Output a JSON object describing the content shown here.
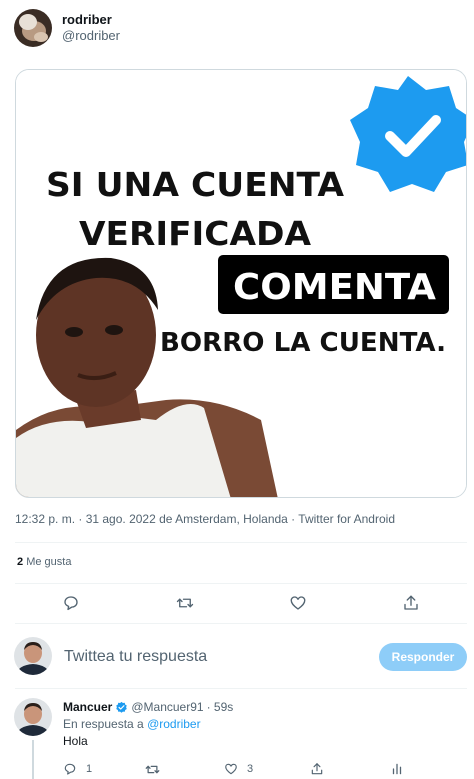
{
  "author": {
    "name": "rodriber",
    "handle": "@rodriber"
  },
  "media": {
    "line1": "SI UNA CUENTA",
    "line2": "VERIFICADA",
    "line3": "COMENTA",
    "line4": "BORRO LA CUENTA."
  },
  "meta": {
    "text": "12:32 p. m. · 31 ago. 2022 de Amsterdam, Holanda · Twitter for Android"
  },
  "likes": {
    "count": "2",
    "label": "Me gusta"
  },
  "compose": {
    "placeholder": "Twittea tu respuesta",
    "button": "Responder"
  },
  "reply": {
    "name": "Mancuer",
    "handle": "@Mancuer91",
    "time": "· 59s",
    "replying_prefix": "En respuesta a",
    "replying_to": "@rodriber",
    "text": "Hola",
    "reply_count": "1",
    "like_count": "3"
  },
  "colors": {
    "accent": "#1d9bf0",
    "button_disabled": "#8ecdf8",
    "verified_badge": "#1d9bf0"
  },
  "icons": [
    "reply-icon",
    "retweet-icon",
    "like-icon",
    "share-icon",
    "analytics-icon",
    "verified-icon"
  ]
}
